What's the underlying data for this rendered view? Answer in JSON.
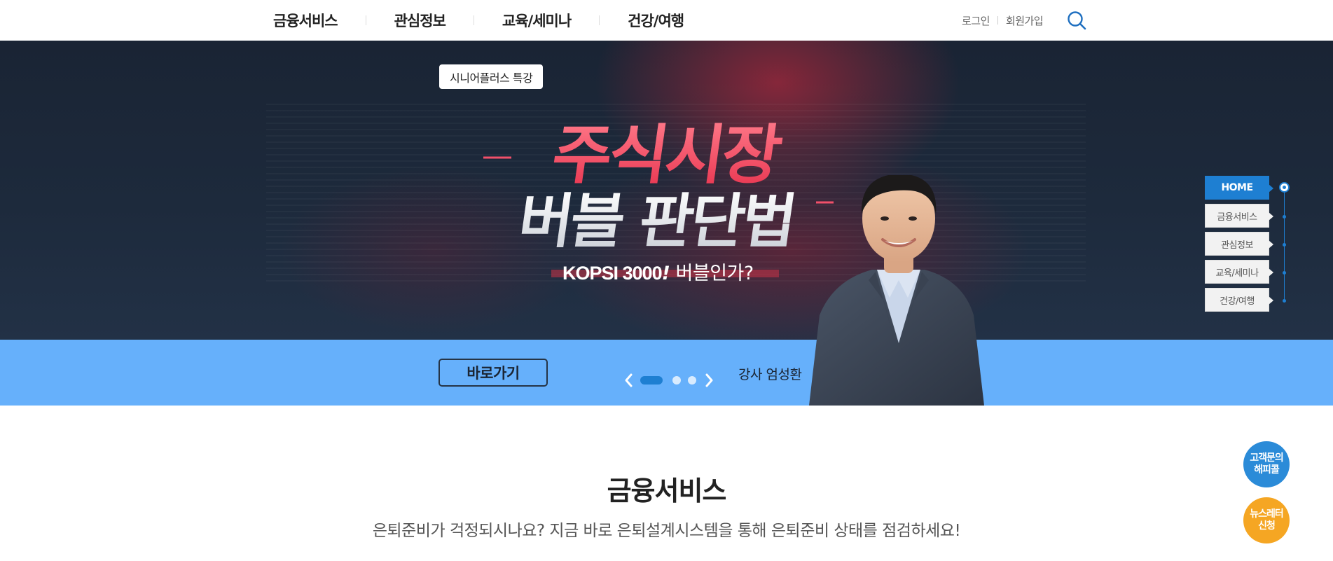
{
  "header": {
    "nav": [
      "금융서비스",
      "관심정보",
      "교육/세미나",
      "건강/여행"
    ],
    "login": "로그인",
    "signup": "회원가입",
    "search_icon": "search-icon"
  },
  "hero": {
    "tag": "시니어플러스 특강",
    "title_line1": "주식시장",
    "title_line2": "버블 판단법",
    "subtitle_bold": "KOPSI 3000",
    "subtitle_mark": "!",
    "subtitle_rest": "버블인가?",
    "go_button": "바로가기",
    "lecturer": "강사 엄성환",
    "slide_count": 3,
    "active_slide": 1
  },
  "quick_nav": {
    "items": [
      "HOME",
      "금융서비스",
      "관심정보",
      "교육/세미나",
      "건강/여행"
    ],
    "active": "HOME"
  },
  "section": {
    "title": "금융서비스",
    "desc": "은퇴준비가 걱정되시나요? 지금 바로 은퇴설계시스템을 통해 은퇴준비 상태를 점검하세요!"
  },
  "float": {
    "btn1_line1": "고객문의",
    "btn1_line2": "해피콜",
    "btn2_line1": "뉴스레터",
    "btn2_line2": "신청"
  },
  "colors": {
    "accent_blue": "#1e7fd2",
    "band_blue": "#66b0fb",
    "hero_dark": "#1d2a3c",
    "title_red": "#f2506a",
    "orange": "#f5a623"
  }
}
